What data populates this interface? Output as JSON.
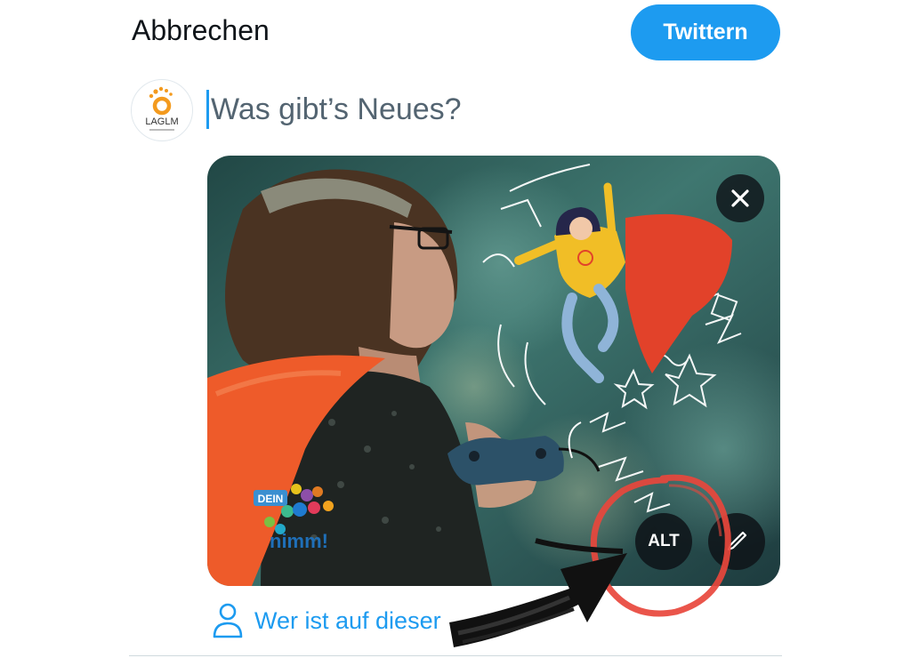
{
  "header": {
    "cancel_label": "Abbrechen",
    "tweet_label": "Twittern"
  },
  "profile": {
    "avatar_text": "LAGLM"
  },
  "composer": {
    "placeholder": "Was gibt’s Neues?"
  },
  "media": {
    "close_icon": "close-icon",
    "alt_label": "ALT",
    "edit_icon": "pencil-icon",
    "logo_text_top": "DEIN",
    "logo_text_bottom": "nimm!"
  },
  "tag_people": {
    "label": "Wer ist auf dieser",
    "icon": "person-icon"
  },
  "colors": {
    "accent": "#1d9bf0",
    "annotation_circle": "#e8463c",
    "cape": "#ee5b2a"
  }
}
